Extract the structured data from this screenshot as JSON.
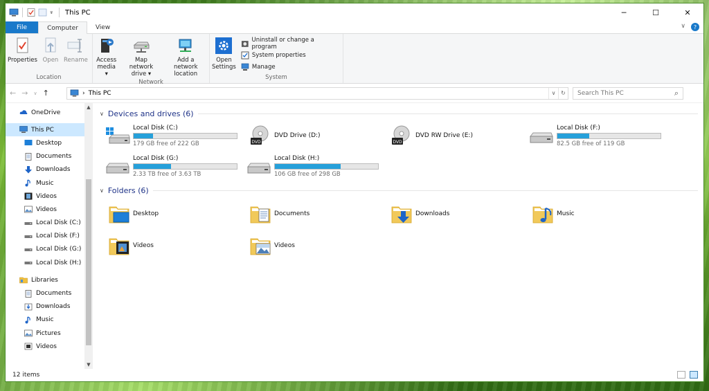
{
  "window": {
    "title": "This PC",
    "controls": {
      "minimize": "─",
      "maximize": "☐",
      "close": "✕"
    }
  },
  "ribbon_tabs": {
    "file": "File",
    "computer": "Computer",
    "view": "View",
    "expand": "∨",
    "help": "?"
  },
  "ribbon": {
    "location": {
      "label": "Location",
      "properties": "Properties",
      "open": "Open",
      "rename": "Rename"
    },
    "network": {
      "label": "Network",
      "access_media_1": "Access",
      "access_media_2": "media ▾",
      "map_drive_1": "Map network",
      "map_drive_2": "drive ▾",
      "add_location_1": "Add a network",
      "add_location_2": "location"
    },
    "system": {
      "label": "System",
      "open_settings_1": "Open",
      "open_settings_2": "Settings",
      "uninstall": "Uninstall or change a program",
      "system_properties": "System properties",
      "manage": "Manage"
    }
  },
  "address": {
    "back": "←",
    "forward": "→",
    "recent": "∨",
    "up": "↑",
    "sep": "›",
    "path": "This PC",
    "dropdown": "∨",
    "refresh": "↻",
    "search_placeholder": "Search This PC",
    "search_icon": "⌕"
  },
  "nav": {
    "onedrive": "OneDrive",
    "this_pc": "This PC",
    "this_pc_items": [
      "Desktop",
      "Documents",
      "Downloads",
      "Music",
      "Videos",
      "Videos",
      "Local Disk (C:)",
      "Local Disk (F:)",
      "Local Disk (G:)",
      "Local Disk (H:)"
    ],
    "libraries": "Libraries",
    "library_items": [
      "Documents",
      "Downloads",
      "Music",
      "Pictures",
      "Videos"
    ],
    "scroll_up": "▲",
    "scroll_down": "▼"
  },
  "sections": {
    "devices": "Devices and drives (6)",
    "folders": "Folders (6)",
    "chevron": "∨"
  },
  "drives": [
    {
      "name": "Local Disk (C:)",
      "free": "179 GB free of 222 GB",
      "used_fraction": 0.19,
      "kind": "system-disk"
    },
    {
      "name": "DVD Drive (D:)",
      "free": "",
      "used_fraction": null,
      "kind": "dvd"
    },
    {
      "name": "DVD RW Drive (E:)",
      "free": "",
      "used_fraction": null,
      "kind": "dvd"
    },
    {
      "name": "Local Disk (F:)",
      "free": "82.5 GB free of 119 GB",
      "used_fraction": 0.31,
      "kind": "disk"
    },
    {
      "name": "Local Disk (G:)",
      "free": "2.33 TB free of 3.63 TB",
      "used_fraction": 0.36,
      "kind": "disk"
    },
    {
      "name": "Local Disk (H:)",
      "free": "106 GB free of 298 GB",
      "used_fraction": 0.64,
      "kind": "disk"
    }
  ],
  "dvd_label": "DVD",
  "folders": [
    {
      "name": "Desktop",
      "kind": "desktop"
    },
    {
      "name": "Documents",
      "kind": "documents"
    },
    {
      "name": "Downloads",
      "kind": "downloads"
    },
    {
      "name": "Music",
      "kind": "music"
    },
    {
      "name": "Videos",
      "kind": "videos"
    },
    {
      "name": "Videos",
      "kind": "pictures"
    }
  ],
  "status": {
    "count": "12 items"
  },
  "colors": {
    "accent": "#1979ca",
    "bar_fill": "#26a0da",
    "section_header": "#1e3287",
    "selection": "#cce8ff"
  }
}
